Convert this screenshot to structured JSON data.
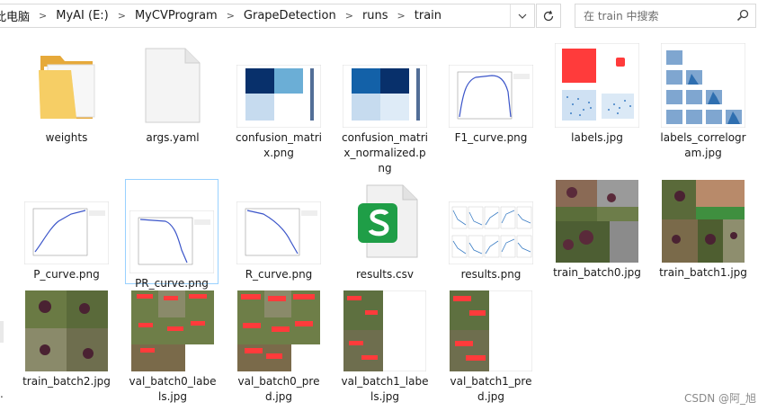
{
  "breadcrumb": {
    "items": [
      "此电脑",
      "MyAI (E:)",
      "MyCVProgram",
      "GrapeDetection",
      "runs",
      "train"
    ],
    "separator": ">"
  },
  "search": {
    "placeholder": "在 train 中搜索"
  },
  "icons": {
    "dropdown": "chevron-down-icon",
    "refresh": "refresh-icon",
    "search": "search-icon"
  },
  "files": [
    {
      "name": "weights",
      "kind": "folder"
    },
    {
      "name": "args.yaml",
      "kind": "yaml"
    },
    {
      "name": "confusion_matrix.png",
      "kind": "confusion"
    },
    {
      "name": "confusion_matrix_normalized.png",
      "kind": "confusion-normalized"
    },
    {
      "name": "F1_curve.png",
      "kind": "curve-f1"
    },
    {
      "name": "labels.jpg",
      "kind": "labels"
    },
    {
      "name": "labels_correlogram.jpg",
      "kind": "correlogram"
    },
    {
      "name": "P_curve.png",
      "kind": "curve-p"
    },
    {
      "name": "PR_curve.png",
      "kind": "curve-pr",
      "selected": true
    },
    {
      "name": "R_curve.png",
      "kind": "curve-r"
    },
    {
      "name": "results.csv",
      "kind": "csv"
    },
    {
      "name": "results.png",
      "kind": "results"
    },
    {
      "name": "train_batch0.jpg",
      "kind": "mosaic"
    },
    {
      "name": "train_batch1.jpg",
      "kind": "mosaic"
    },
    {
      "name": "train_batch2.jpg",
      "kind": "mosaic"
    },
    {
      "name": "val_batch0_labels.jpg",
      "kind": "val-mosaic"
    },
    {
      "name": "val_batch0_pred.jpg",
      "kind": "val-mosaic"
    },
    {
      "name": "val_batch1_labels.jpg",
      "kind": "val-half"
    },
    {
      "name": "val_batch1_pred.jpg",
      "kind": "val-half"
    }
  ],
  "colors": {
    "selection_border": "#99d1ff",
    "folder": "#f3c659",
    "csv_green": "#1f9e47",
    "matrix_dark": "#08306b",
    "curve_blue": "#3b55c9",
    "label_red": "#ff3b3b"
  },
  "watermark": "CSDN @阿_旭"
}
